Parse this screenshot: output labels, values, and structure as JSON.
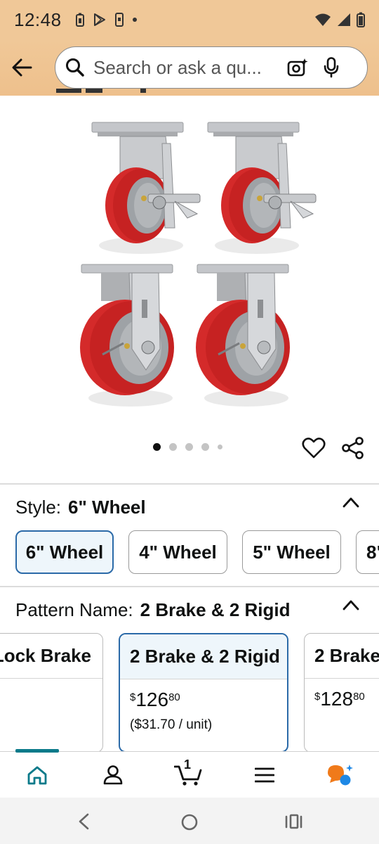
{
  "status_bar": {
    "time": "12:48"
  },
  "search": {
    "placeholder": "Search or ask a qu..."
  },
  "gallery": {
    "image_count": 5,
    "active_index": 0
  },
  "style": {
    "label": "Style:",
    "selected": "6\" Wheel",
    "options": [
      "6\" Wheel",
      "4\" Wheel",
      "5\" Wheel",
      "8\""
    ]
  },
  "pattern": {
    "label": "Pattern Name:",
    "selected": "2 Brake & 2 Rigid",
    "options": [
      {
        "name": "Lock Brake",
        "price_symbol": "",
        "price_whole": "",
        "price_fraction": "",
        "unit": ""
      },
      {
        "name": "2 Brake & 2 Rigid",
        "price_symbol": "$",
        "price_whole": "126",
        "price_fraction": "80",
        "unit": "($31.70 / unit)"
      },
      {
        "name": "2 Brake",
        "price_symbol": "$",
        "price_whole": "128",
        "price_fraction": "80",
        "unit": ""
      }
    ]
  },
  "bottom_nav": {
    "cart_count": "1"
  },
  "colors": {
    "header_bg": "#f0c898",
    "selected_border": "#2b6aa8",
    "selected_bg": "#eef6fb",
    "wheel_red": "#d42a2a",
    "home_active": "#0a7a8a",
    "rufus_orange": "#f07a1a",
    "rufus_blue": "#1e88e5"
  },
  "icons": [
    "back-arrow-icon",
    "search-icon",
    "camera-icon",
    "microphone-icon",
    "heart-icon",
    "share-icon",
    "chevron-up-icon",
    "home-icon",
    "account-icon",
    "cart-icon",
    "menu-icon",
    "rufus-icon"
  ]
}
